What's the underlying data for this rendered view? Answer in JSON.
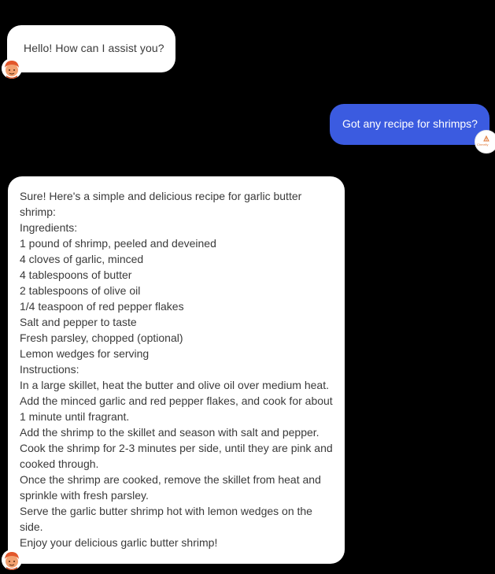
{
  "chat": {
    "greeting": "Hello! How can I assist you?",
    "user_message": "Got any recipe for shrimps?",
    "bot_reply_lines": [
      "Sure! Here's a simple and delicious recipe for garlic butter",
      "shrimp:",
      "Ingredients:",
      "1 pound of shrimp, peeled and deveined",
      "4 cloves of garlic, minced",
      "4 tablespoons of butter",
      "2 tablespoons of olive oil",
      "1/4 teaspoon of red pepper flakes",
      "Salt and pepper to taste",
      "Fresh parsley, chopped (optional)",
      "Lemon wedges for serving",
      "Instructions:",
      "In a large skillet, heat the butter and olive oil over medium heat.",
      "Add the minced garlic and red pepper flakes, and cook for about",
      "1 minute until fragrant.",
      "Add the shrimp to the skillet and season with salt and pepper.",
      "Cook the shrimp for 2-3 minutes per side, until they are pink and",
      "cooked through.",
      "Once the shrimp are cooked, remove the skillet from heat and",
      "sprinkle with fresh parsley.",
      "Serve the garlic butter shrimp hot with lemon wedges on the",
      "side.",
      "Enjoy your delicious garlic butter shrimp!"
    ]
  },
  "avatars": {
    "bot_icon": "chef-avatar-icon",
    "user_icon": "brand-logo-icon",
    "user_logo_text": "Chmelly"
  },
  "colors": {
    "background": "#000000",
    "bot_bubble": "#ffffff",
    "user_bubble": "#3b5be0",
    "accent": "#e07a3a"
  }
}
